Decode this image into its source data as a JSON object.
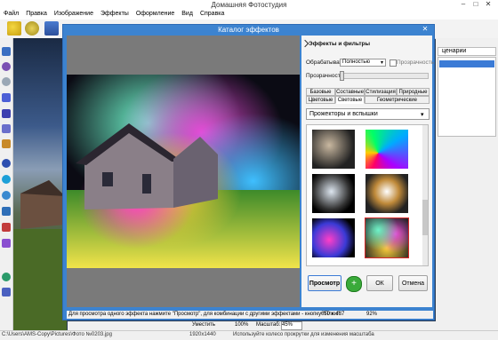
{
  "app": {
    "title": "Домашняя Фотостудия",
    "window_controls": [
      "–",
      "□",
      "✕"
    ]
  },
  "menu": {
    "items": [
      "Файл",
      "Правка",
      "Изображение",
      "Эффекты",
      "Оформление",
      "Вид",
      "Справка"
    ]
  },
  "right_panel": {
    "tab_label": "ценарии"
  },
  "dialog": {
    "title": "Каталог эффектов",
    "close_glyph": "✕",
    "hint": "Для просмотра одного эффекта нажмите \"Просмотр\", для комбинации с другими эффектами - кнопку \"Плюс\":",
    "image_size": "650 x 487",
    "zoom_percent": "92%"
  },
  "effects_panel": {
    "header": "Эффекты и фильтры",
    "process_label": "Обрабатывать",
    "process_value": "Полностью",
    "process_arrow": "▾",
    "transparency_check_label": "Прозрачность",
    "transparency_label": "Прозрачность",
    "transparency_value": 0,
    "tabs_row1": [
      "Базовые",
      "Составные",
      "Стилизация",
      "Природные"
    ],
    "tabs_row2": [
      "Цветовые",
      "Световые",
      "Геометрические"
    ],
    "active_tab": "Световые",
    "category": "Прожекторы и вспышки",
    "category_arrow": "▾",
    "selected_thumbnail_index": 5
  },
  "buttons": {
    "preview": "Просмотр",
    "plus": "+",
    "ok": "ОК",
    "cancel": "Отмена"
  },
  "zoombar": {
    "fit_label": "Уместить",
    "zoom100": "100%",
    "scale_label": "Масштаб:",
    "scale_value": "45%"
  },
  "statusbar": {
    "path": "C:\\Users\\AMS-Copy\\Pictures\\Фото №0203.jpg",
    "resolution": "1920x1440",
    "tip": "Используйте колесо прокрутки для изменения масштаба"
  },
  "colors": {
    "dialog_title_bg": "#3c83d0",
    "selection_blue": "#3b7bd6",
    "selected_thumb_border": "#d62828",
    "plus_button_green": "#3aaa3a"
  }
}
